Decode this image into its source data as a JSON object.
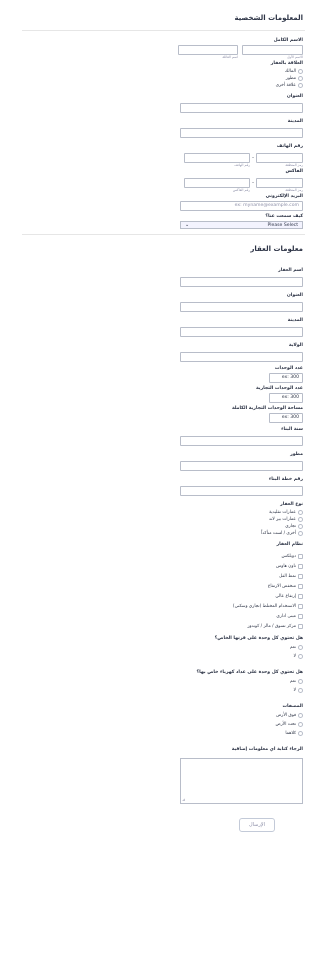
{
  "personal": {
    "title": "المعلومات الشخصية",
    "full_name": {
      "label": "الاسم الكامل",
      "first_sub": "الاسم الأول",
      "last_sub": "اسم العائلة"
    },
    "relation": {
      "label": "العلاقة بالعقار",
      "options": [
        "المالك",
        "مطور",
        "علاقة أخرى"
      ]
    },
    "address": {
      "label": "العنوان"
    },
    "city": {
      "label": "المدينة"
    },
    "phone": {
      "label": "رقم الهاتف",
      "area_sub": "رمز المنطقة",
      "number_sub": "رقم الهاتف",
      "dash": "-"
    },
    "fax": {
      "label": "الفاكس",
      "area_sub": "رمز المنطقة",
      "number_sub": "رقم الفاكس",
      "dash": "-"
    },
    "email": {
      "label": "البريد الإلكتروني",
      "placeholder": "ex: myname@example.com"
    },
    "source": {
      "label": "كيف سمعت عنا؟",
      "selected": "Please Select"
    }
  },
  "property": {
    "title": "معلومات العقار",
    "name": {
      "label": "اسم العقار"
    },
    "address": {
      "label": "العنوان"
    },
    "city": {
      "label": "المدينة"
    },
    "state": {
      "label": "الولاية"
    },
    "units": {
      "label": "عدد الوحدات",
      "placeholder": "ex: 300"
    },
    "commercial_units": {
      "label": "عدد الوحدات التجارية",
      "placeholder": "ex: 300"
    },
    "commercial_area": {
      "label": "مساحة الوحدات التجارية الكاملة",
      "placeholder": "ex: 300"
    },
    "year_built": {
      "label": "سنة البناء"
    },
    "developer": {
      "label": "مطور"
    },
    "plan_number": {
      "label": "رقم خطة البناء"
    },
    "property_type": {
      "label": "نوع العقار",
      "options": [
        "عمارات تقليدية",
        "عمارات بير لاند",
        "تجاري",
        "أخرى / لست متأكداً"
      ]
    },
    "property_system": {
      "label": "نظام العقار",
      "options": [
        "دوبلكس",
        "تاون هاوس",
        "نمط الفل",
        "منخفض الارتفاع",
        "إرتفاع عالي",
        "الاستخدام المختلط (تجاري وسكني)",
        "مبنى اداري",
        "مركز تسوق / مالز / كوندوز"
      ]
    },
    "unit_owner": {
      "label": "هل تحتوي كل وحدة على فرنها الخاص؟",
      "options": [
        "نعم",
        "لا"
      ]
    },
    "electric_meter": {
      "label": "هل تحتوي كل وحدة على عداد كهرباء خاص بها؟",
      "options": [
        "نعم",
        "لا"
      ]
    },
    "parking": {
      "label": "المصفات",
      "options": [
        "فوق الأرض",
        "تحت الأرض",
        "كلاهما"
      ]
    },
    "extra_info": {
      "label": "الرجاء كتابة اي معلومات إضافية"
    }
  },
  "submit_label": "الإرسال",
  "resize_glyph": "⊿",
  "chevron_glyph": "⌄"
}
